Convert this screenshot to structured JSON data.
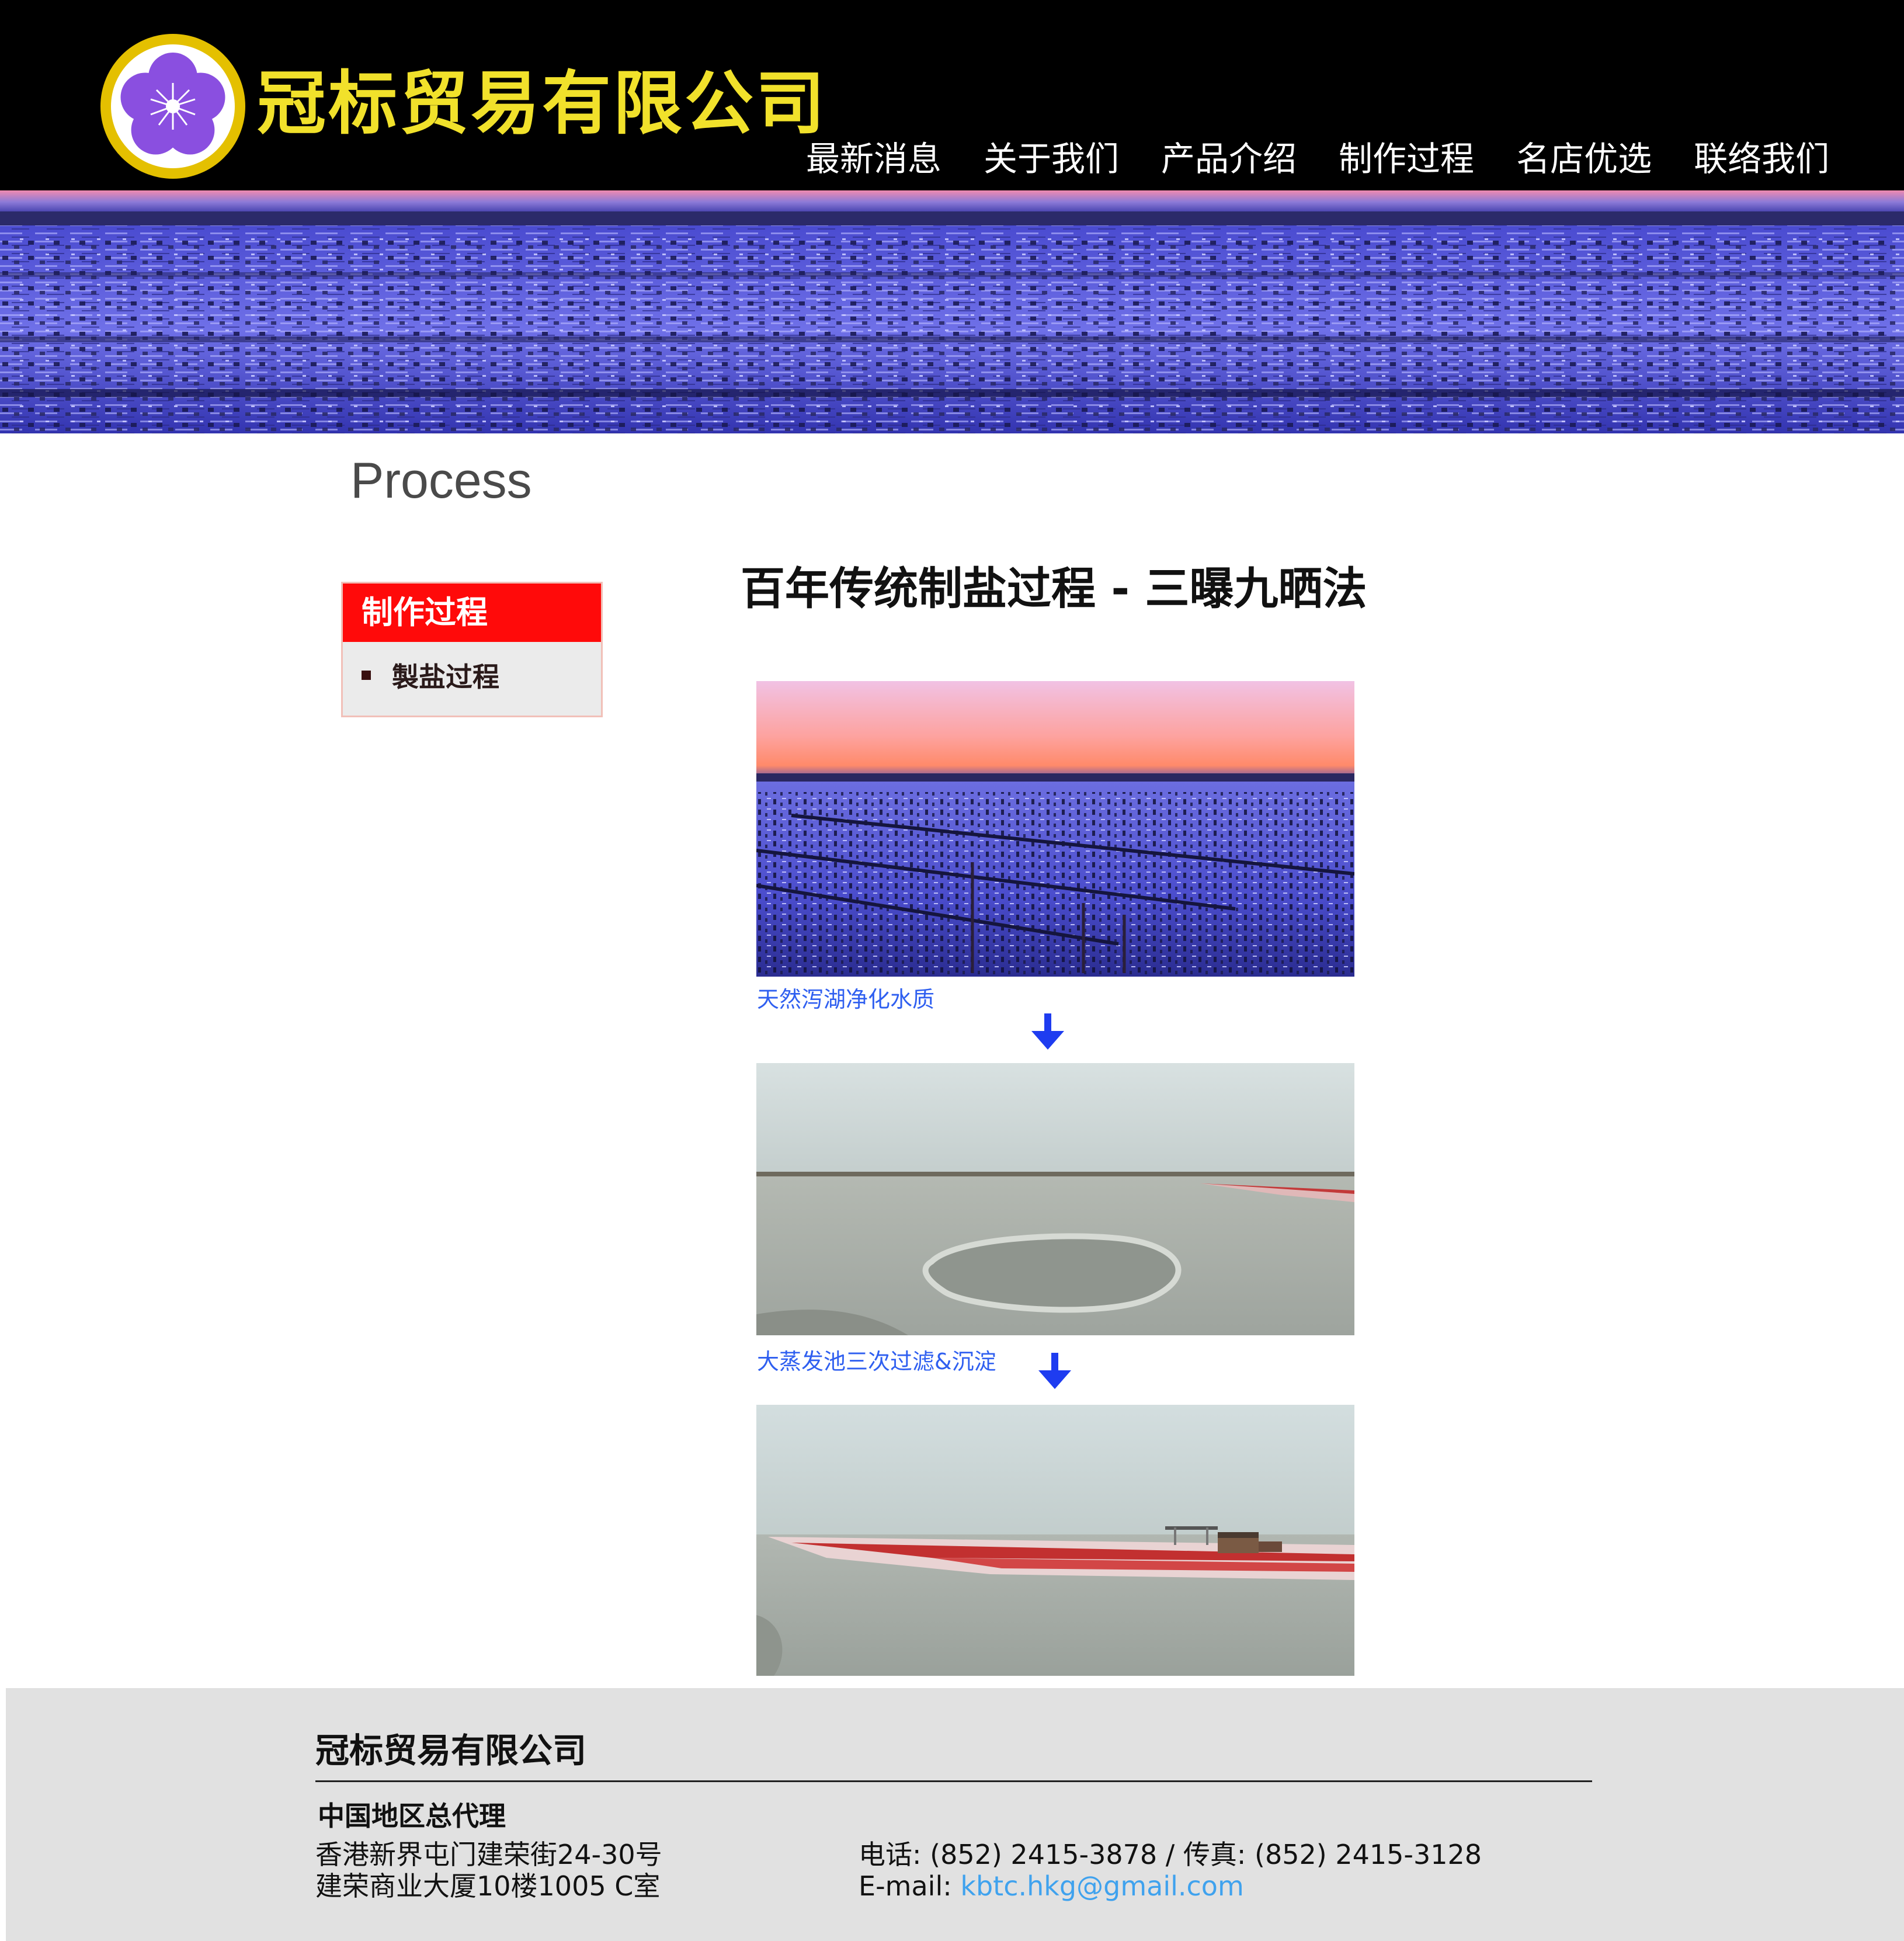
{
  "header": {
    "company_name": "冠标贸易有限公司",
    "nav": [
      "最新消息",
      "关于我们",
      "产品介绍",
      "制作过程",
      "名店优选",
      "联络我们"
    ]
  },
  "page": {
    "title": "Process"
  },
  "side_menu": {
    "title": "制作过程",
    "items": [
      {
        "label": "製盐过程"
      }
    ]
  },
  "article": {
    "heading": "百年传统制盐过程 - 三曝九晒法",
    "steps": [
      {
        "caption": "天然泻湖净化水质"
      },
      {
        "caption": "大蒸发池三次过滤&沉淀"
      },
      {
        "caption": ""
      }
    ]
  },
  "footer": {
    "company": "冠标贸易有限公司",
    "agent_title": "中国地区总代理",
    "address_line1": "香港新界屯门建荣街24-30号",
    "address_line2": "建荣商业大厦10楼1005 C室",
    "phone_fax": "电话: (852) 2415-3878 / 传真: (852) 2415-3128",
    "email_label": "E-mail: ",
    "email": "kbtc.hkg@gmail.com"
  },
  "colors": {
    "header_bg": "#000000",
    "brand_yellow": "#f1e12b",
    "side_menu_red": "#ff0a0a",
    "caption_blue": "#2f5ff0",
    "arrow_blue": "#1e3cf0",
    "link_blue": "#3fa2ee",
    "footer_bg": "#e1e1e1"
  },
  "icons": {
    "logo": "purple-flower-logo",
    "step_arrow": "down-arrow-icon",
    "menu_bullet": "square-bullet"
  }
}
